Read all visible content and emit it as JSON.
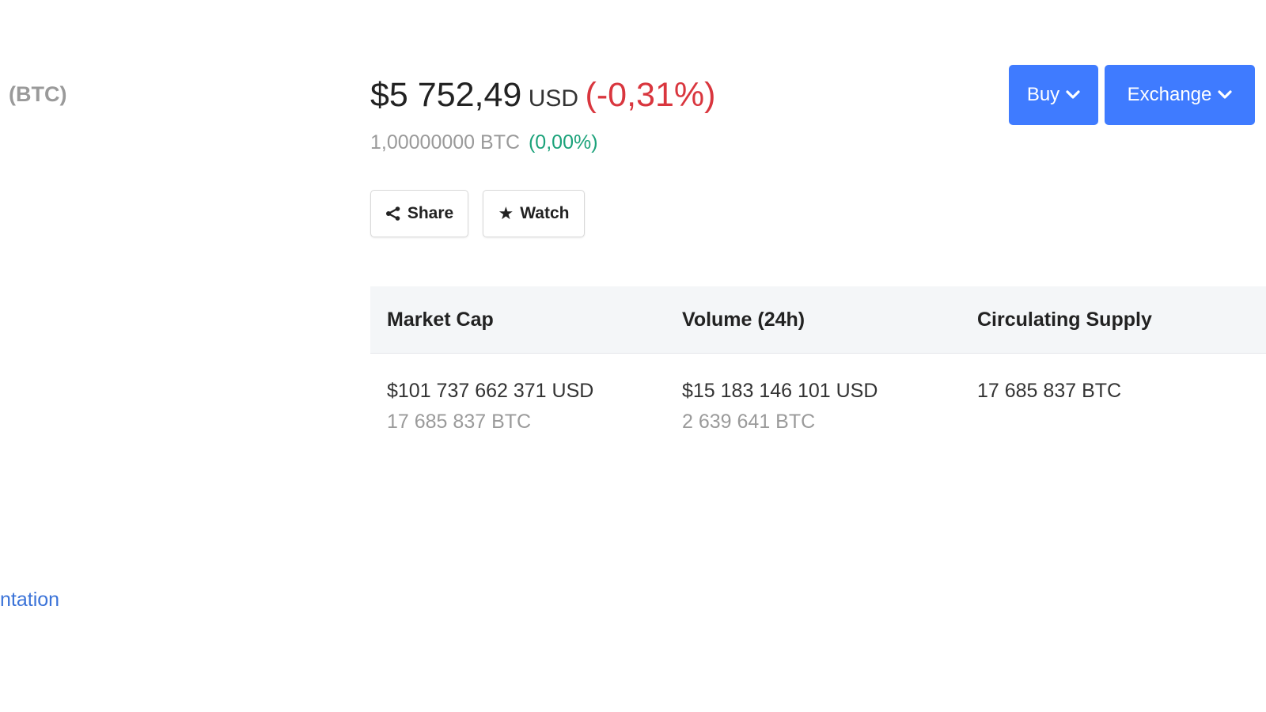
{
  "coin": {
    "ticker": "(BTC)"
  },
  "price": {
    "value": "$5 752,49",
    "currency": "USD",
    "change": "(-0,31%)",
    "btc_amount": "1,00000000 BTC",
    "btc_change": "(0,00%)"
  },
  "actions": {
    "share_label": "Share",
    "watch_label": "Watch"
  },
  "buttons": {
    "buy_label": "Buy",
    "exchange_label": "Exchange"
  },
  "colors": {
    "primary": "#3f7bff",
    "negative": "#d9363e",
    "positive": "#1ba27a",
    "link": "#3b73d8"
  },
  "stats": {
    "headers": [
      "Market Cap",
      "Volume (24h)",
      "Circulating Supply"
    ],
    "market_cap": {
      "usd": "$101 737 662 371 USD",
      "btc": "17 685 837 BTC"
    },
    "volume": {
      "usd": "$15 183 146 101 USD",
      "btc": "2 639 641 BTC"
    },
    "supply": {
      "btc": "17 685 837 BTC"
    }
  },
  "links": {
    "documentation_partial": "ntation"
  },
  "icons": {
    "share": "share-icon",
    "watch": "star-icon",
    "dropdown": "chevron-down-icon"
  }
}
